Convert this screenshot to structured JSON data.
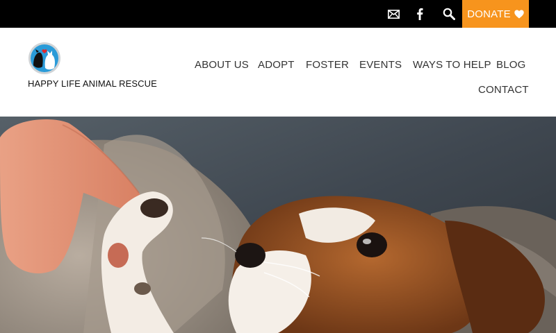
{
  "topbar": {
    "background": "#000000",
    "icons": [
      "mail-icon",
      "facebook-icon",
      "search-icon"
    ],
    "donate": {
      "label": "DONATE",
      "icon": "heart-icon",
      "background": "#f7941d"
    }
  },
  "header": {
    "brand": "HAPPY LIFE ANIMAL RESCUE",
    "logo_icon": "cat-dog-logo-icon"
  },
  "nav": {
    "items": [
      {
        "label": "ABOUT US"
      },
      {
        "label": "ADOPT"
      },
      {
        "label": "FOSTER"
      },
      {
        "label": "EVENTS"
      },
      {
        "label": "WAYS TO HELP"
      },
      {
        "label": "BLOG"
      },
      {
        "label": "CONTACT"
      }
    ]
  },
  "hero": {
    "image": "hand touching puppy paw"
  }
}
